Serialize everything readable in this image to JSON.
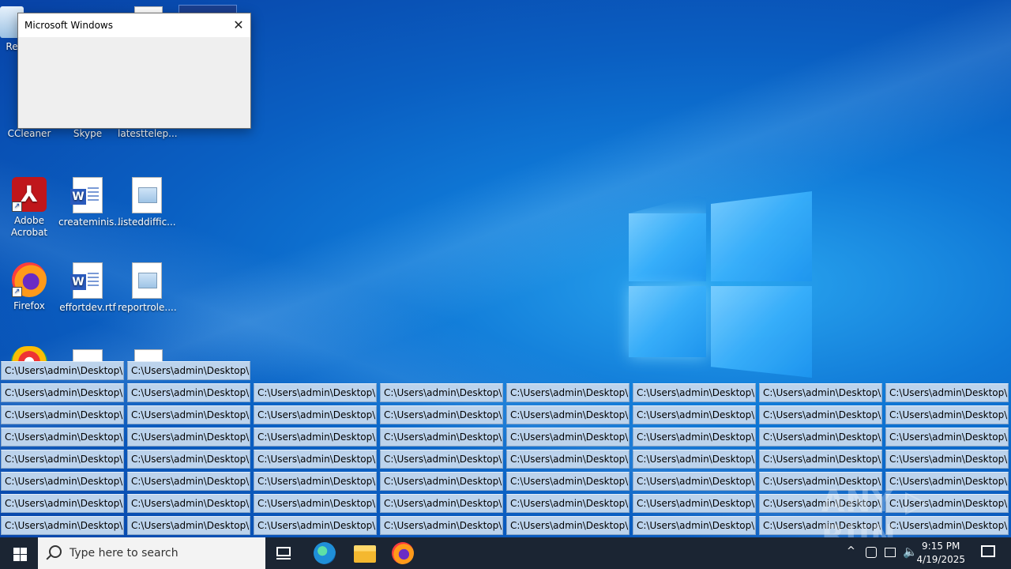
{
  "desktop": {
    "icons": [
      {
        "label": "Re",
        "name": "recycle-bin-icon"
      },
      {
        "label": "CCleaner",
        "name": "ccleaner-icon"
      },
      {
        "label": "Skype",
        "name": "skype-icon"
      },
      {
        "label": "latesttelep...",
        "name": "latesttelep-file-icon"
      },
      {
        "label": "Adobe Acrobat",
        "name": "adobe-acrobat-icon"
      },
      {
        "label": "createminis...",
        "name": "createminis-doc-icon"
      },
      {
        "label": "listeddiffic...",
        "name": "listeddiffic-image-icon"
      },
      {
        "label": "Firefox",
        "name": "firefox-icon"
      },
      {
        "label": "effortdev.rtf",
        "name": "effortdev-doc-icon"
      },
      {
        "label": "reportrole....",
        "name": "reportrole-image-icon"
      }
    ]
  },
  "dialog": {
    "title": "Microsoft Windows",
    "close_glyph": "✕"
  },
  "tiles": {
    "label": "C:\\Users\\admin\\Desktop\\d...",
    "rows": [
      {
        "count": 2
      },
      {
        "count": 8
      },
      {
        "count": 8
      },
      {
        "count": 8
      },
      {
        "count": 8
      },
      {
        "count": 8
      },
      {
        "count": 8
      },
      {
        "count": 8
      }
    ]
  },
  "watermark": {
    "text": "ANY ▷ RUN"
  },
  "taskbar": {
    "search_placeholder": "Type here to search",
    "time": "9:15 PM",
    "date": "4/19/2025",
    "tray_chevron": "^"
  },
  "colors": {
    "desktop_accent": "#0f78d6",
    "taskbar": "#1b2533",
    "tile": "#bcd3ec"
  }
}
